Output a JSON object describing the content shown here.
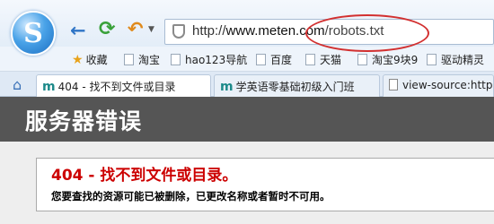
{
  "browser": {
    "logo_letter": "S",
    "address": {
      "protocol": "http://",
      "host": "www.meten.com",
      "path": "/robots.txt"
    }
  },
  "bookmarks": [
    {
      "label": "收藏",
      "icon": "star-icon"
    },
    {
      "label": "淘宝",
      "icon": "page-icon"
    },
    {
      "label": "hao123导航",
      "icon": "page-icon"
    },
    {
      "label": "百度",
      "icon": "page-icon"
    },
    {
      "label": "天猫",
      "icon": "page-icon"
    },
    {
      "label": "淘宝9块9",
      "icon": "page-icon"
    },
    {
      "label": "驱动精灵",
      "icon": "page-icon"
    }
  ],
  "tabs": [
    {
      "label": "404 - 找不到文件或目录",
      "active": true
    },
    {
      "label": "学英语零基础初级入门班",
      "active": false
    },
    {
      "label": "view-source:http:/",
      "active": false
    }
  ],
  "page": {
    "header_title": "服务器错误",
    "error_code": "404 - 找不到文件或目录。",
    "error_description": "您要查找的资源可能已被删除，已更改名称或者暂时不可用。"
  },
  "colors": {
    "header_bg": "#555555",
    "error_red": "#cc0000",
    "annotation": "#d23030"
  }
}
